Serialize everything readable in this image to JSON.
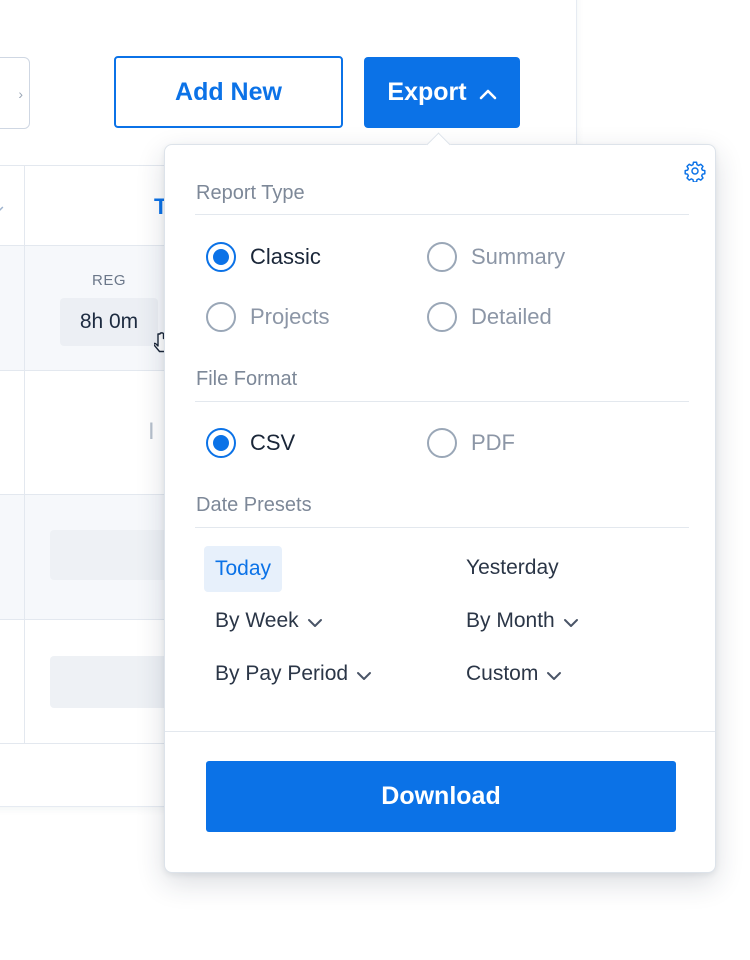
{
  "toolbar": {
    "add_new_label": "Add New",
    "export_label": "Export"
  },
  "table": {
    "column_heading_partial": "T",
    "reg_label": "REG",
    "reg_value": "8h 0m",
    "behind_text_partial": "I"
  },
  "export_panel": {
    "report_type": {
      "title": "Report Type",
      "options": [
        {
          "label": "Classic",
          "checked": true
        },
        {
          "label": "Summary",
          "checked": false
        },
        {
          "label": "Projects",
          "checked": false
        },
        {
          "label": "Detailed",
          "checked": false
        }
      ]
    },
    "file_format": {
      "title": "File Format",
      "options": [
        {
          "label": "CSV",
          "checked": true
        },
        {
          "label": "PDF",
          "checked": false
        }
      ]
    },
    "date_presets": {
      "title": "Date Presets",
      "items": [
        {
          "label": "Today",
          "active": true
        },
        {
          "label": "Yesterday",
          "active": false
        },
        {
          "label": "By Week",
          "active": false
        },
        {
          "label": "By Month",
          "active": false
        },
        {
          "label": "By Pay Period",
          "active": false
        },
        {
          "label": "Custom",
          "active": false
        }
      ]
    },
    "download_label": "Download"
  },
  "colors": {
    "accent": "#0b72e7",
    "muted_text": "#7d8898",
    "active_preset_bg": "#e7f0fb"
  },
  "icons": {
    "export_chevron": "chevron-up-icon",
    "settings": "gear-icon",
    "preset_dropdown": "chevron-down-icon",
    "cursor": "hand-pointer-icon"
  }
}
